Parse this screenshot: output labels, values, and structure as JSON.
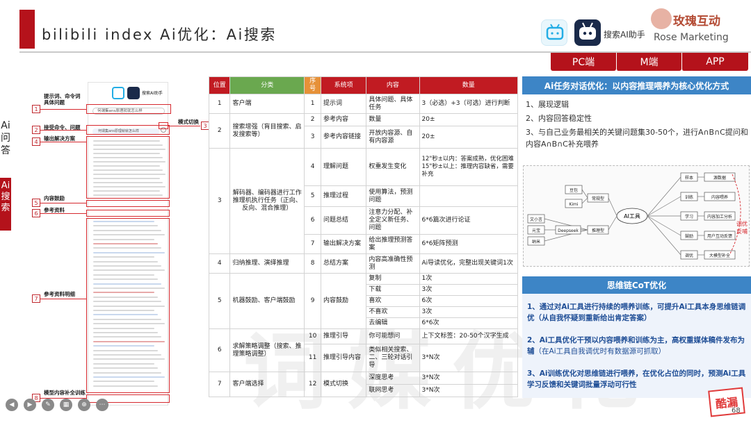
{
  "header": {
    "title": "bilibili index Ai优化：Ai搜索",
    "assistant_label": "搜索AI助手",
    "brand_cn": "玫瑰互动",
    "brand_en": "Rose Marketing"
  },
  "platform_tabs": [
    "PC端",
    "M端",
    "APP"
  ],
  "left_labels": {
    "a": "Ai问答",
    "b": "Ai搜索"
  },
  "phone": {
    "assistant_label": "搜索AI助手",
    "search_text": "何谓集ans原理就就怎么样",
    "toggle_label": "模式切换"
  },
  "annotations": [
    {
      "num": "1",
      "text": "提示词、命令词\n具体问题"
    },
    {
      "num": "2",
      "text": "接受命令、问题"
    },
    {
      "num": "3",
      "text": "模式切换"
    },
    {
      "num": "4",
      "text": "输出解决方案"
    },
    {
      "num": "5",
      "text": "内容鼓励"
    },
    {
      "num": "6",
      "text": "参考资料"
    },
    {
      "num": "7",
      "text": "参考资料明细"
    },
    {
      "num": "8",
      "text": "模型内容补全训练"
    }
  ],
  "table": {
    "headers": [
      "位置",
      "分类",
      "序号",
      "系统项",
      "内容",
      "数量"
    ],
    "rows": [
      {
        "pos": "1",
        "cat": "客户端",
        "no": "1",
        "item": "提示词",
        "content": "具体问题、具体任务",
        "qty": "3（必选）+3（可选）进行判断"
      },
      {
        "pos": "2",
        "cat": "搜索增强（肓目搜索、启发搜索等）",
        "no": "2",
        "item": "参考内容",
        "content": "数量",
        "qty": "20±"
      },
      {
        "no": "3",
        "item": "参考内容链接",
        "content": "开放内容源、自有内容源",
        "qty": "20±"
      },
      {
        "pos": "3",
        "cat": "解码器、编码器进行工作\n推理机执行任务（正向、反向、混合推理）",
        "no": "4",
        "item": "理解问题",
        "content": "权重发生变化",
        "qty": "12\"秒±以内：答案成熟，优化困难\n15\"秒±以上：推理内容缺省，需要补充"
      },
      {
        "no": "5",
        "item": "推理过程",
        "content": "使用算法，预测问题",
        "qty": ""
      },
      {
        "no": "6",
        "item": "问题总结",
        "content": "注意力分配、补全定义新任务、问题",
        "qty": "6*6篇次进行论证"
      },
      {
        "no": "7",
        "item": "输出解决方案",
        "content": "给出推理预测答案",
        "qty": "6*6矩阵预测"
      },
      {
        "pos": "4",
        "cat": "归纳推理、演绎推理",
        "no": "8",
        "item": "总结方案",
        "content": "内容高准确性预测",
        "qty": "Ai导读优化，完整出现关键词1次"
      },
      {
        "pos": "5",
        "cat": "机器鼓励、客户端鼓励",
        "no": "9",
        "item": "内容鼓励",
        "content": "复制",
        "qty": "1次"
      },
      {
        "content": "下载",
        "qty": "3次"
      },
      {
        "content": "喜欢",
        "qty": "6次"
      },
      {
        "content": "不喜欢",
        "qty": "3次"
      },
      {
        "content": "去编辑",
        "qty": "6*6次"
      },
      {
        "pos": "6",
        "cat": "求解策略调整（搜索、推理策略调整）",
        "no": "10",
        "item": "推理引导",
        "content": "你可能想问",
        "qty": "上下文标签：20-50个汉字生成"
      },
      {
        "no": "11",
        "item": "推理引导内容",
        "content": "类似相关搜索、二、三轮对话引导",
        "qty": "3*N次"
      },
      {
        "pos": "7",
        "cat": "客户端选择",
        "no": "12",
        "item": "模式切换",
        "content": "深度思考",
        "qty": "3*N次"
      },
      {
        "content": "联网思考",
        "qty": "3*N次"
      }
    ]
  },
  "panel1": {
    "heading": "Ai任务对话优化：以内容推理喂养为核心优化方式",
    "items": [
      "1、展现逻辑",
      "2、内容回答稳定性",
      "3、与自己业务最相关的关键问题集30-50个，进行A∩B∩C提问和内容A∩B∩C补充喂养"
    ]
  },
  "mindmap": {
    "center": "AI工具",
    "left_nodes": [
      "常规型",
      "推理型"
    ],
    "left_leaves": [
      "豆包",
      "Kimi",
      "文小言",
      "元宝",
      "纳米",
      "Deepseek"
    ],
    "right_nodes": [
      "样本",
      "训练",
      "学习",
      "鼓励",
      "调优"
    ],
    "right_leaves": [
      "源数据",
      "内容喂养",
      "内容加工分析",
      "用户互动反馈",
      "大模型补全"
    ],
    "note": "调优\n反哺"
  },
  "panel2": {
    "heading": "思维链CoT优化",
    "items": [
      {
        "text": "1、通过对Ai工具进行持续的喂养训练，可提升Ai工具本身思维链调优（从自我怀疑到重新给出肯定答案）",
        "note": ""
      },
      {
        "text": "2、Ai工具优化干预以内容喂养和训练为主，高权重媒体稿件发布为辅",
        "note": "（在Ai工具自我调优时有数据源可抓取）"
      },
      {
        "text": "3、Ai训练优化对思维链进行喂养，在优化占位的同时，预测Ai工具学习反馈和关键词批量浮动可行性",
        "note": ""
      }
    ]
  },
  "page_number": "68",
  "watermark": "词媒优化",
  "corner_mark": "酷漏",
  "colors": {
    "brand_red": "#b4121b",
    "blue": "#3d85c6",
    "green": "#6aa84f",
    "orange": "#e69138"
  }
}
